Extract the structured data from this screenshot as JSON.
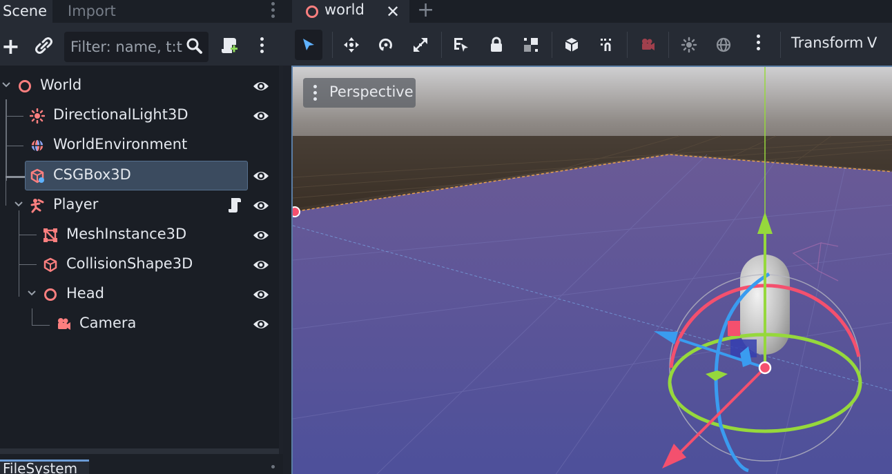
{
  "left_dock": {
    "tabs": [
      "Scene",
      "Import"
    ],
    "filter_placeholder": "Filter: name, t:t",
    "bottom_tab": "FileSystem"
  },
  "tree": [
    {
      "label": "World",
      "icon": "node3d-icon",
      "visible_toggle": true
    },
    {
      "label": "DirectionalLight3D",
      "icon": "directional-light-icon",
      "visible_toggle": true
    },
    {
      "label": "WorldEnvironment",
      "icon": "world-environment-icon",
      "visible_toggle": false
    },
    {
      "label": "CSGBox3D",
      "icon": "csg-box-icon",
      "visible_toggle": true,
      "selected": true
    },
    {
      "label": "Player",
      "icon": "character-body-icon",
      "visible_toggle": true,
      "has_script": true
    },
    {
      "label": "MeshInstance3D",
      "icon": "mesh-instance-icon",
      "visible_toggle": true
    },
    {
      "label": "CollisionShape3D",
      "icon": "collision-shape-icon",
      "visible_toggle": true
    },
    {
      "label": "Head",
      "icon": "node3d-icon",
      "visible_toggle": true
    },
    {
      "label": "Camera",
      "icon": "camera-icon",
      "visible_toggle": true
    }
  ],
  "editor": {
    "scene_tab": "world",
    "toolbar_menus": [
      "Transform",
      "V"
    ],
    "viewport_mode": "Perspective"
  },
  "colors": {
    "node_red": "#fc7f7f",
    "accent_blue": "#6b9bd6",
    "selection_bg": "#3b4b5f",
    "floor_purple": "#5a5a9a",
    "gizmo_x": "#f4506e",
    "gizmo_y": "#96d83c",
    "gizmo_z": "#3a9cf0"
  }
}
